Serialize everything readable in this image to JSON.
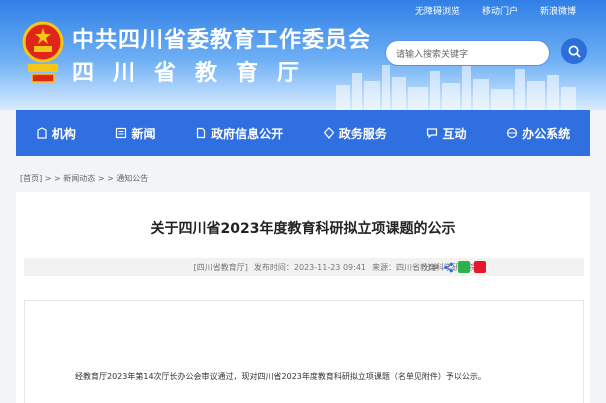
{
  "header": {
    "toplinks": [
      "无障碍浏览",
      "移动门户",
      "新浪微博"
    ],
    "title": "中共四川省委教育工作委员会",
    "subtitle": "四川省教育厅",
    "search_placeholder": "请输入搜索关键字"
  },
  "nav": {
    "items": [
      {
        "label": "机构",
        "icon": "building-icon"
      },
      {
        "label": "新闻",
        "icon": "news-icon"
      },
      {
        "label": "政府信息公开",
        "icon": "document-icon"
      },
      {
        "label": "政务服务",
        "icon": "service-icon"
      },
      {
        "label": "互动",
        "icon": "chat-icon"
      },
      {
        "label": "办公系统",
        "icon": "office-icon"
      }
    ]
  },
  "breadcrumb": "[首页] > > 新闻动态 > > 通知公告",
  "article": {
    "title": "关于四川省2023年度教育科研拟立项课题的公示",
    "source": "[四川省教育厅]",
    "date": "发布时间：2023-11-23 09:41",
    "origin": "来源：四川省教育科学研究院",
    "share_label": "分享",
    "body": "经教育厅2023年第14次厅长办公会审议通过，现对四川省2023年度教育科研拟立项课题（名单见附件）予以公示。"
  },
  "colors": {
    "primary": "#2f6fe0",
    "header_top": "#2f7fe6"
  }
}
